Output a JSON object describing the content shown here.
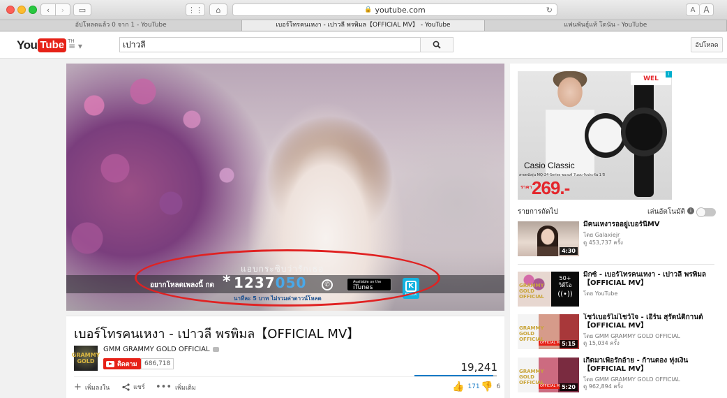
{
  "browser": {
    "url": "youtube.com",
    "tabs": [
      {
        "label": "อัปโหลดแล้ว 0 จาก 1 - YouTube",
        "active": false
      },
      {
        "label": "เบอร์โทรคนเหงา - เปาวลี พรพิมล【OFFICIAL MV】 - YouTube",
        "active": true
      },
      {
        "label": "แฟนพันธุ์แท้ โดนัน - YouTube",
        "active": false
      }
    ],
    "font_small": "A",
    "font_large": "A"
  },
  "header": {
    "logo_you": "You",
    "logo_tube": "Tube",
    "region": "TH",
    "search_value": "เปาวลี",
    "upload_label": "อัปโหลด"
  },
  "player": {
    "headline": "แอบกระซิบว่ารักเธอ",
    "cta": "อยากโหลดเพลงนี้ กด",
    "star": "*",
    "code_part1": "1237",
    "code_part2": "050",
    "price_note": "นาทีละ 5 บาท ไม่รวมค่าดาวน์โหลด",
    "itunes_small": "Available on the",
    "itunes_big": "iTunes",
    "kkbox_letter": "K",
    "kkbox_label": "KKBOX"
  },
  "video": {
    "title": "เบอร์โทรคนเหงา - เปาวลี พรพิมล【OFFICIAL MV】",
    "channel": "GMM GRAMMY GOLD OFFICIAL",
    "avatar_line1": "GRAMMY",
    "avatar_line2": "GOLD",
    "subscribe_label": "ติดตาม",
    "subscriber_count": "686,718",
    "views": "19,241",
    "like_ratio": 0.96,
    "add_label": "เพิ่มลงใน",
    "share_label": "แชร์",
    "more_label": "เพิ่มเติม",
    "likes": "171",
    "dislikes": "6"
  },
  "sidebar": {
    "ad": {
      "badge": "WEL",
      "brand": "Casio Classic",
      "sub": "สายหนังรุ่น MQ-24-Series ของแท้ 7แบบ รับประกัน 1 ปี",
      "price_label": "ราคา",
      "price": "269.-",
      "info": "i"
    },
    "up_next": "รายการถัดไป",
    "autoplay": "เล่นอัตโนมัติ",
    "autoplay_info": "i",
    "autoplay_on": false,
    "related": [
      {
        "title": "มีคนเหงารออยู่เบอร์นี้MV",
        "channel": "โดย Galaxiejr",
        "views": "ดู 453,737 ครั้ง",
        "duration": "4:30"
      },
      {
        "title": "มิกซ์ - เบอร์โทรคนเหงา - เปาวลี พรพิมล【OFFICIAL MV】",
        "channel": "โดย YouTube",
        "views": "",
        "duration": "",
        "mix_count": "50+",
        "mix_label": "วิดีโอ",
        "mix_signal": "((•))",
        "gold_line1": "GRAMMY",
        "gold_line2": "GOLD",
        "gold_line3": "OFFICIAL"
      },
      {
        "title": "โชว์เบอร์ไม่โชว์ใจ - เอิร์น สุรัตน์ติกานต์【OFFICIAL MV】",
        "channel": "โดย GMM GRAMMY GOLD OFFICIAL",
        "views": "ดู 15,034 ครั้ง",
        "duration": "5:15",
        "gold_line1": "GRAMMY",
        "gold_line2": "GOLD",
        "gold_line3": "OFFICIAL",
        "tag": "OFFICIAL MUSIC"
      },
      {
        "title": "เกิดมาเพื่อรักอ้าย - ก้านตอง ทุ่งเงิน【OFFICIAL MV】",
        "channel": "โดย GMM GRAMMY GOLD OFFICIAL",
        "views": "ดู 962,894 ครั้ง",
        "duration": "5:20",
        "gold_line1": "GRAMMY",
        "gold_line2": "GOLD",
        "gold_line3": "OFFICIAL",
        "tag": "OFFICIAL MUSIC"
      }
    ]
  },
  "icons": {
    "back": "‹",
    "forward": "›",
    "sidebar": "▭",
    "grid": "⋮⋮",
    "home": "⌂",
    "lock": "🔒",
    "reload": "↻",
    "guide": "≡ ▾",
    "search": "search-icon",
    "add": "+",
    "share": "<",
    "more": "•••",
    "like": "👍",
    "dislike": "👎",
    "phone": "✆",
    "apple": ""
  },
  "colors": {
    "brand_red": "#e62117",
    "link_blue": "#167ac6",
    "highlight_ellipse": "#e02222"
  }
}
